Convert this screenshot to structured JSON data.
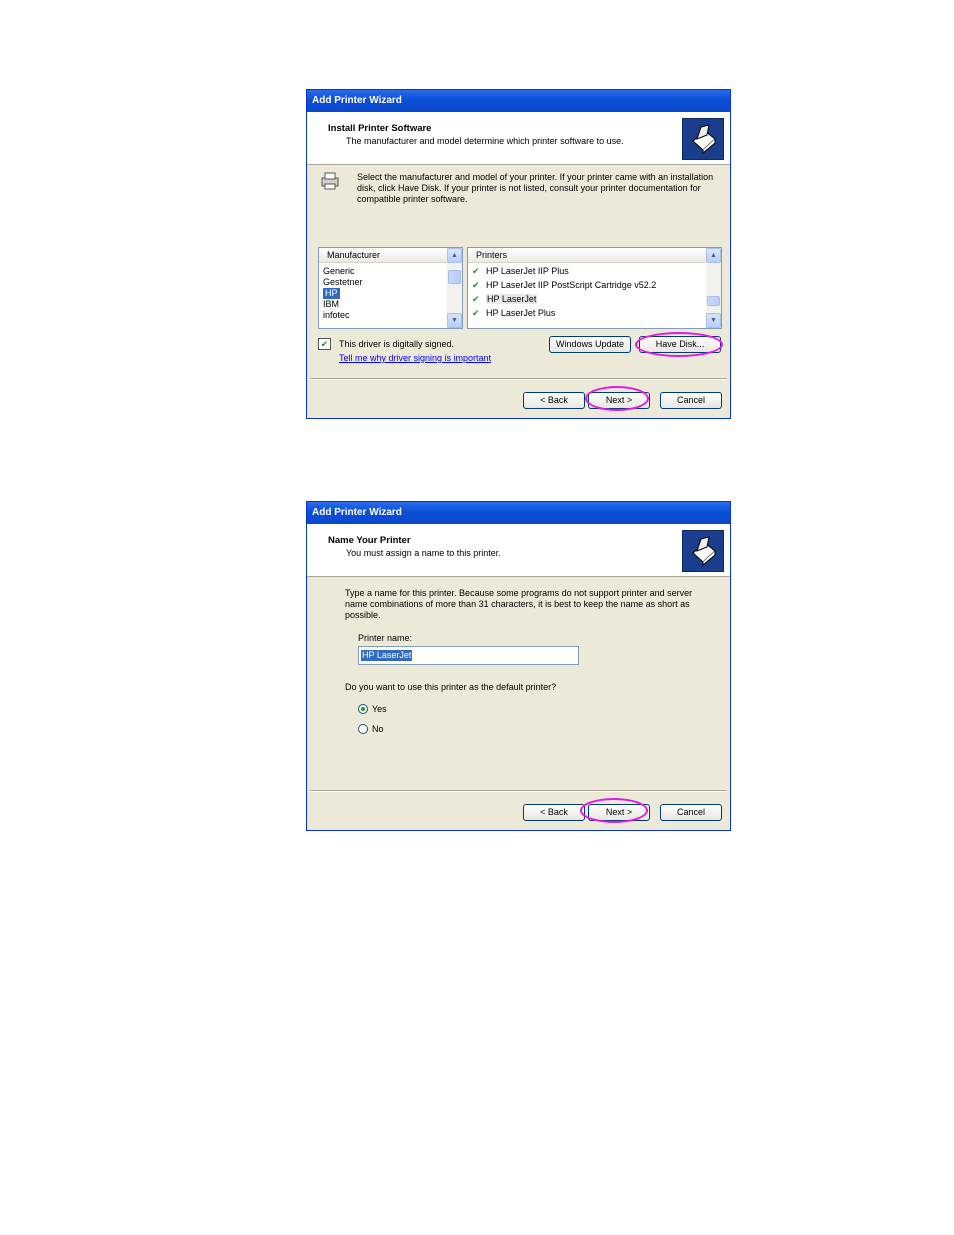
{
  "wizard1": {
    "title": "Add Printer Wizard",
    "header_title": "Install Printer Software",
    "header_subtitle": "The manufacturer and model determine which printer software to use.",
    "instruction_line1": "Select the manufacturer and model of your printer. If your printer came with an installation",
    "instruction_line2": "disk, click Have Disk. If your printer is not listed, consult your printer documentation for",
    "instruction_line3": "compatible printer software.",
    "manufacturer_header": "Manufacturer",
    "manufacturers": [
      "Generic",
      "Gestetner",
      "HP",
      "IBM",
      "infotec"
    ],
    "selected_manufacturer": "HP",
    "printers_header": "Printers",
    "printers": [
      "HP LaserJet IIP Plus",
      "HP LaserJet IIP PostScript Cartridge v52.2",
      "HP LaserJet",
      "HP LaserJet Plus"
    ],
    "selected_printer": "HP LaserJet",
    "signed_text": "This driver is digitally signed.",
    "signing_link": "Tell me why driver signing is important",
    "windows_update_label": "Windows Update",
    "have_disk_label": "Have Disk...",
    "back_label": "< Back",
    "next_label": "Next >",
    "cancel_label": "Cancel"
  },
  "wizard2": {
    "title": "Add Printer Wizard",
    "header_title": "Name Your Printer",
    "header_subtitle": "You must assign a name to this printer.",
    "instruction_line1": "Type a name for this printer. Because some programs do not support printer and server",
    "instruction_line2": "name combinations of more than 31 characters, it is best to keep the name as short as",
    "instruction_line3": "possible.",
    "printer_name_label": "Printer name:",
    "printer_name_value": "HP LaserJet",
    "default_question": "Do you want to use this printer as the default printer?",
    "yes_label": "Yes",
    "no_label": "No",
    "default_selected": "Yes",
    "back_label": "< Back",
    "next_label": "Next >",
    "cancel_label": "Cancel"
  },
  "colors": {
    "titlebar": "#0a4fd6",
    "dialog_bg": "#ece9d8",
    "selection": "#316ac5",
    "highlight_ring": "#e617e6"
  },
  "icons": {
    "header_icon": "printer-wizard-icon",
    "printer_icon": "printer-icon",
    "signed_icon": "driver-signed-icon",
    "printer_item_icon": "printer-driver-icon"
  }
}
